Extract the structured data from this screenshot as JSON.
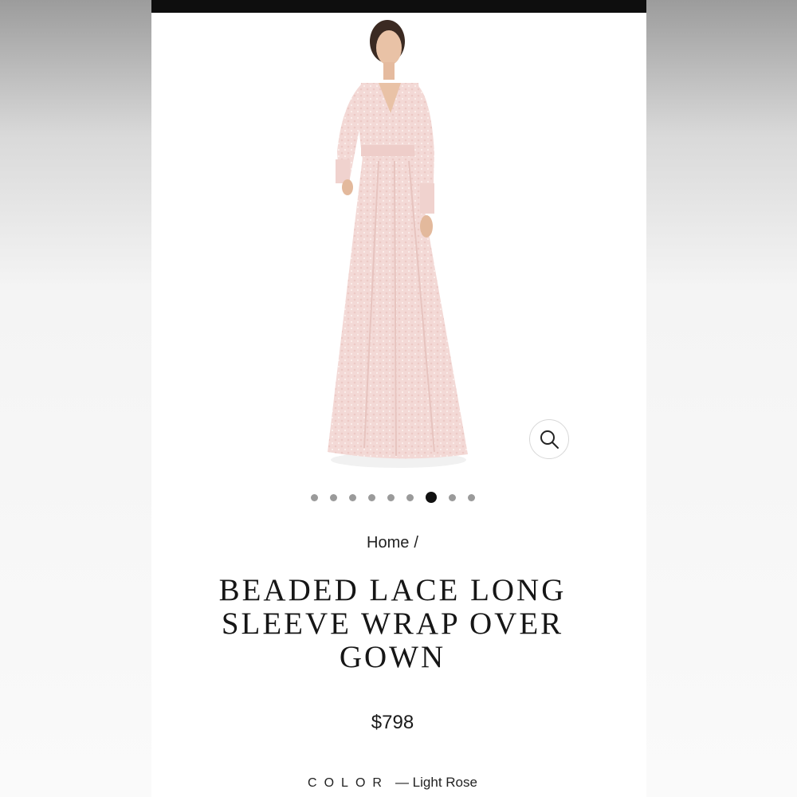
{
  "product": {
    "breadcrumb_home": "Home",
    "breadcrumb_separator": "/",
    "title": "BEADED LACE LONG SLEEVE WRAP OVER GOWN",
    "price": "$798",
    "color_label": "COLOR",
    "color_value": "— Light Rose",
    "image_description_icon": "gown-photo",
    "zoom_icon": "search-icon"
  },
  "gallery": {
    "total_slides": 9,
    "active_slide": 7
  },
  "colors": {
    "gown": "#f3d9d6",
    "status_bar": "#0e0e0e"
  }
}
